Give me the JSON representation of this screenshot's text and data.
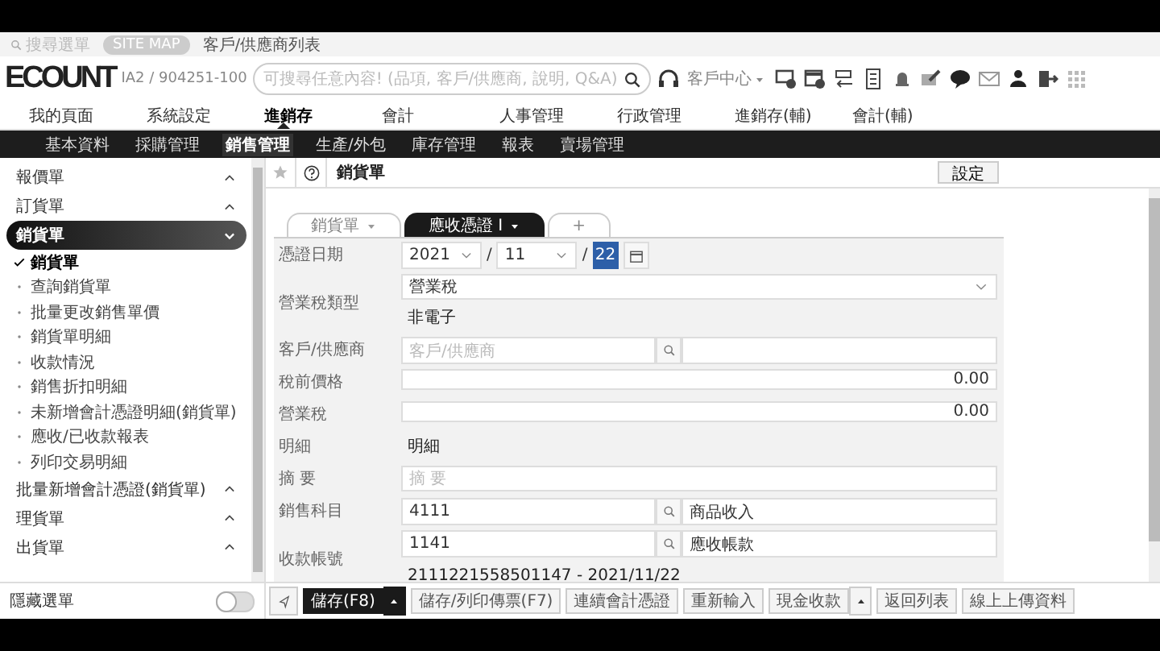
{
  "top_bar": {
    "search_placeholder": "搜尋選單",
    "site_map": "SITE MAP",
    "breadcrumb": "客戶/供應商列表"
  },
  "header": {
    "logo": "ECOUNT",
    "account": "IA2 / 904251-100",
    "search_placeholder": "可搜尋任意內容! (品項, 客戶/供應商, 說明, Q&A)",
    "customer_center": "客戶中心"
  },
  "main_menu": [
    {
      "label": "我的頁面",
      "selected": false
    },
    {
      "label": "系統設定",
      "selected": false
    },
    {
      "label": "進銷存",
      "selected": true
    },
    {
      "label": "會計",
      "selected": false
    },
    {
      "label": "人事管理",
      "selected": false
    },
    {
      "label": "行政管理",
      "selected": false
    },
    {
      "label": "進銷存(輔)",
      "selected": false
    },
    {
      "label": "會計(輔)",
      "selected": false
    }
  ],
  "sub_menu": [
    {
      "label": "基本資料",
      "selected": false
    },
    {
      "label": "採購管理",
      "selected": false
    },
    {
      "label": "銷售管理",
      "selected": true
    },
    {
      "label": "生產/外包",
      "selected": false
    },
    {
      "label": "庫存管理",
      "selected": false
    },
    {
      "label": "報表",
      "selected": false
    },
    {
      "label": "賣場管理",
      "selected": false
    }
  ],
  "sidebar": {
    "groups": [
      {
        "label": "報價單",
        "expanded": false,
        "selected": false
      },
      {
        "label": "訂貨單",
        "expanded": false,
        "selected": false
      },
      {
        "label": "銷貨單",
        "expanded": true,
        "selected": true,
        "children": [
          {
            "label": "銷貨單",
            "selected": true
          },
          {
            "label": "查詢銷貨單",
            "selected": false
          },
          {
            "label": "批量更改銷售單價",
            "selected": false
          },
          {
            "label": "銷貨單明細",
            "selected": false
          },
          {
            "label": "收款情況",
            "selected": false
          },
          {
            "label": "銷售折扣明細",
            "selected": false
          },
          {
            "label": "未新增會計憑證明細(銷貨單)",
            "selected": false
          },
          {
            "label": "應收/已收款報表",
            "selected": false
          },
          {
            "label": "列印交易明細",
            "selected": false
          }
        ]
      },
      {
        "label": "批量新增會計憑證(銷貨單)",
        "expanded": false,
        "selected": false
      },
      {
        "label": "理貨單",
        "expanded": false,
        "selected": false
      },
      {
        "label": "出貨單",
        "expanded": false,
        "selected": false
      }
    ],
    "hide_menu": {
      "label": "隱藏選單",
      "on": false
    }
  },
  "page": {
    "title": "銷貨單",
    "settings": "設定",
    "tabs": [
      {
        "label": "銷貨單",
        "selected": false
      },
      {
        "label": "應收憑證 I",
        "selected": true
      }
    ],
    "add_tab": "+",
    "fields": [
      {
        "kind": "date",
        "label": "憑證日期",
        "year": "2021",
        "separator": "/",
        "month": "11",
        "day": "22"
      },
      {
        "kind": "select",
        "label": "營業稅類型",
        "value": "營業稅",
        "note": "非電子"
      },
      {
        "kind": "lookup",
        "label": "客戶/供應商",
        "placeholder": "客戶/供應商"
      },
      {
        "kind": "number",
        "label": "稅前價格",
        "value": "0.00"
      },
      {
        "kind": "number",
        "label": "營業稅",
        "value": "0.00"
      },
      {
        "kind": "static",
        "label": "明細",
        "value": "明細"
      },
      {
        "kind": "text",
        "label": "摘 要",
        "placeholder": "摘 要"
      },
      {
        "kind": "lookup",
        "label": "銷售科目",
        "value": "4111",
        "name": "商品收入"
      },
      {
        "kind": "lookup",
        "label": "收款帳號",
        "value": "1141",
        "name": "應收帳款",
        "note": "2111221558501147 - 2021/11/22"
      }
    ],
    "toolbar": [
      {
        "label": "儲存(F8)",
        "kind": "primary",
        "menu": true
      },
      {
        "label": "儲存/列印傳票(F7)",
        "kind": "normal",
        "menu": false
      },
      {
        "label": "連續會計憑證",
        "kind": "normal",
        "menu": false
      },
      {
        "label": "重新輸入",
        "kind": "normal",
        "menu": false
      },
      {
        "label": "現金收款",
        "kind": "normal",
        "menu": true
      },
      {
        "label": "返回列表",
        "kind": "normal",
        "menu": false
      },
      {
        "label": "線上上傳資料",
        "kind": "normal",
        "menu": false
      }
    ]
  }
}
